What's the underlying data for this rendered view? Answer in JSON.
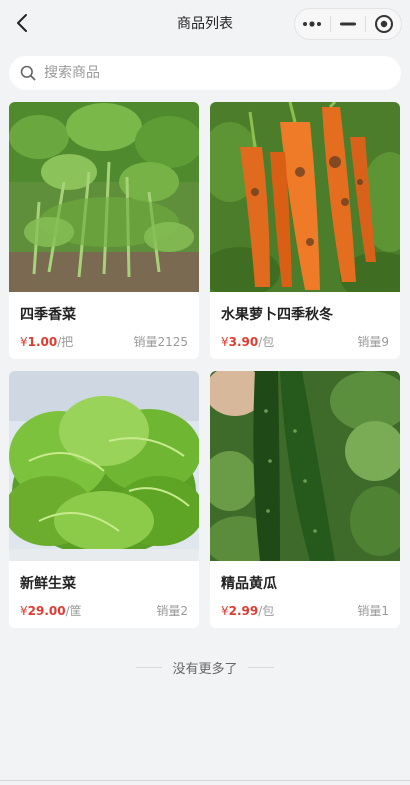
{
  "navbar": {
    "title": "商品列表",
    "back_icon": "chevron-left-icon",
    "capsule_icons": [
      "more-dots-icon",
      "minimize-icon",
      "target-icon"
    ]
  },
  "search": {
    "placeholder": "搜索商品",
    "value": "",
    "icon": "search-icon"
  },
  "products": [
    {
      "name": "四季香菜",
      "currency": "¥",
      "price": "1.00",
      "unit": "/把",
      "sales": "销量2125",
      "image": "coriander"
    },
    {
      "name": "水果萝卜四季秋冬",
      "currency": "¥",
      "price": "3.90",
      "unit": "/包",
      "sales": "销量9",
      "image": "carrot"
    },
    {
      "name": "新鲜生菜",
      "currency": "¥",
      "price": "29.00",
      "unit": "/筐",
      "sales": "销量2",
      "image": "lettuce"
    },
    {
      "name": "精品黄瓜",
      "currency": "¥",
      "price": "2.99",
      "unit": "/包",
      "sales": "销量1",
      "image": "cucumber"
    }
  ],
  "footer": {
    "no_more": "没有更多了"
  },
  "colors": {
    "price": "#e23a2e",
    "background": "#f2f3f5",
    "card": "#ffffff"
  }
}
